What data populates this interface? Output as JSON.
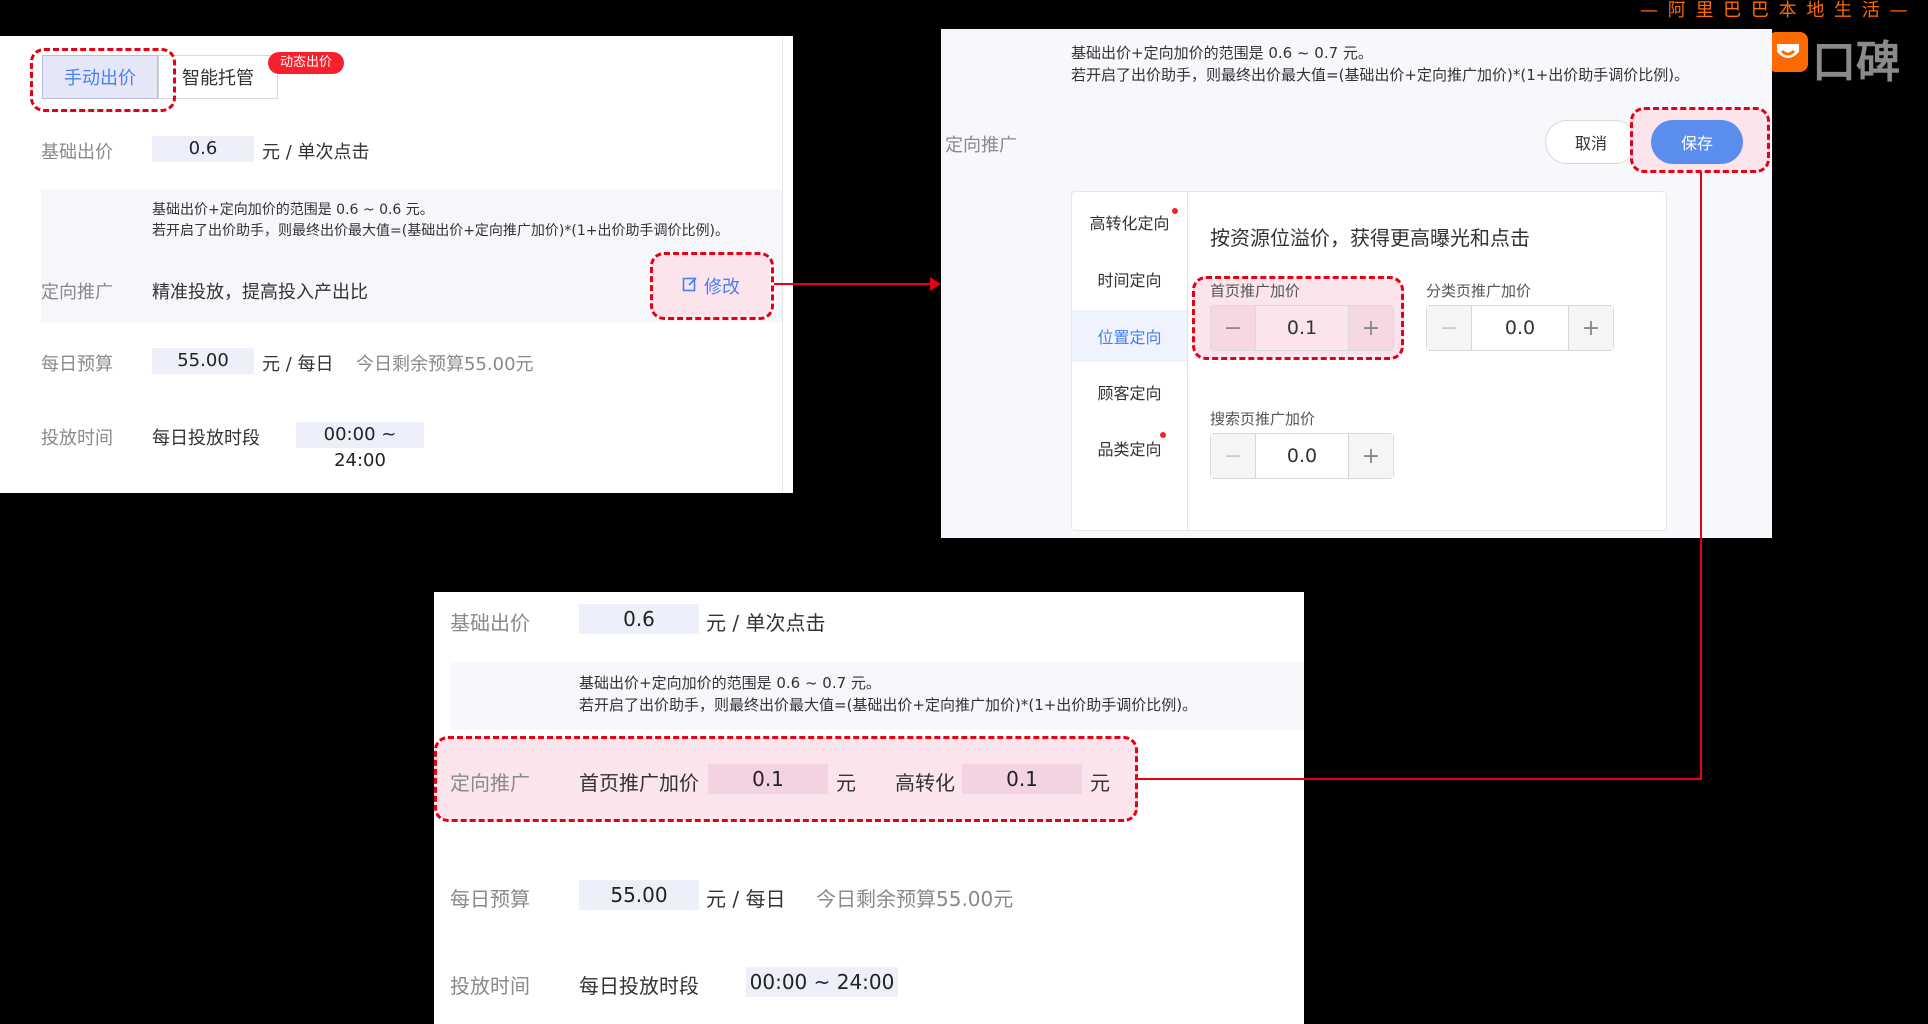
{
  "brand": {
    "tagline": "— 阿 里 巴 巴 本 地 生 活 —",
    "name": "口碑"
  },
  "panel1": {
    "tabs": {
      "manual": "手动出价",
      "smart": "智能托管",
      "badge": "动态出价"
    },
    "base_bid": {
      "label": "基础出价",
      "value": "0.6",
      "unit": "元 / 单次点击"
    },
    "tip": {
      "line1": "基础出价+定向加价的范围是 0.6 ~ 0.6 元。",
      "line2": "若开启了出价助手，则最终出价最大值=(基础出价+定向推广加价)*(1+出价助手调价比例)。"
    },
    "targeting": {
      "label": "定向推广",
      "text": "精准投放，提高投入产出比",
      "edit": "修改"
    },
    "budget": {
      "label": "每日预算",
      "value": "55.00",
      "unit": "元 / 每日",
      "remaining": "今日剩余预算55.00元"
    },
    "schedule": {
      "label": "投放时间",
      "text": "每日投放时段",
      "value": "00:00 ~ 24:00"
    }
  },
  "panel2": {
    "tip": {
      "line1": "基础出价+定向加价的范围是 0.6 ~ 0.7 元。",
      "line2": "若开启了出价助手，则最终出价最大值=(基础出价+定向推广加价)*(1+出价助手调价比例)。"
    },
    "label": "定向推广",
    "cancel": "取消",
    "save": "保存",
    "menu": [
      "高转化定向",
      "时间定向",
      "位置定向",
      "顾客定向",
      "品类定向"
    ],
    "heading": "按资源位溢价，获得更高曝光和点击",
    "fields": {
      "home": {
        "label": "首页推广加价",
        "value": "0.1"
      },
      "category": {
        "label": "分类页推广加价",
        "value": "0.0"
      },
      "search": {
        "label": "搜索页推广加价",
        "value": "0.0"
      }
    },
    "minus": "−",
    "plus": "+"
  },
  "panel3": {
    "base_bid": {
      "label": "基础出价",
      "value": "0.6",
      "unit": "元 / 单次点击"
    },
    "tip": {
      "line1": "基础出价+定向加价的范围是 0.6 ~ 0.7 元。",
      "line2": "若开启了出价助手，则最终出价最大值=(基础出价+定向推广加价)*(1+出价助手调价比例)。"
    },
    "targeting": {
      "label": "定向推广",
      "home_label": "首页推广加价",
      "home_value": "0.1",
      "unit": "元",
      "conv_label": "高转化",
      "conv_value": "0.1"
    },
    "budget": {
      "label": "每日预算",
      "value": "55.00",
      "unit": "元 / 每日",
      "remaining": "今日剩余预算55.00元"
    },
    "schedule": {
      "label": "投放时间",
      "text": "每日投放时段",
      "value": "00:00 ~ 24:00"
    }
  },
  "colors": {
    "accent": "#4a7ff0",
    "highlight_border": "#e60012",
    "highlight_fill": "#fce4ec",
    "badge": "#f5222d",
    "brand_orange": "#ff6a00"
  }
}
